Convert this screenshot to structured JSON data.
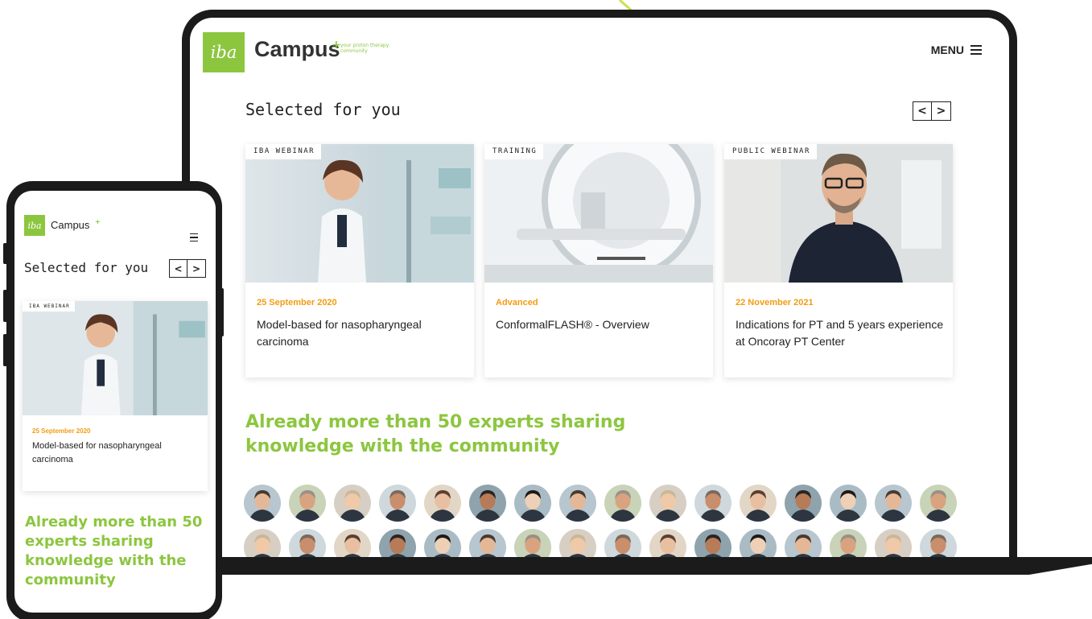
{
  "brand": {
    "logo_text": "iba",
    "name": "Campus",
    "tagline": "your proton therapy community"
  },
  "laptop": {
    "menu_label": "MENU",
    "section_title": "Selected for you",
    "cards": [
      {
        "tag": "IBA WEBINAR",
        "meta": "25 September 2020",
        "title": "Model-based for nasopharyngeal carcinoma"
      },
      {
        "tag": "TRAINING",
        "meta": "Advanced",
        "title": "ConformalFLASH® - Overview"
      },
      {
        "tag": "PUBLIC WEBINAR",
        "meta": "22 November 2021",
        "title": "Indications for PT and 5 years experience at Oncoray PT Center"
      }
    ],
    "experts_heading": "Already more than 50 experts sharing knowledge with the community",
    "expert_avatar_count": 32
  },
  "phone": {
    "section_title": "Selected for you",
    "card": {
      "tag": "IBA WEBINAR",
      "meta": "25 September 2020",
      "title": "Model-based for nasopharyngeal carcinoma"
    },
    "experts_heading": "Already more than 50 experts sharing knowledge with the community"
  },
  "nav": {
    "prev_symbol": "<",
    "next_symbol": ">"
  },
  "colors": {
    "accent_green": "#8cc63f",
    "accent_orange": "#f39c12",
    "frame": "#1b1b1b"
  }
}
